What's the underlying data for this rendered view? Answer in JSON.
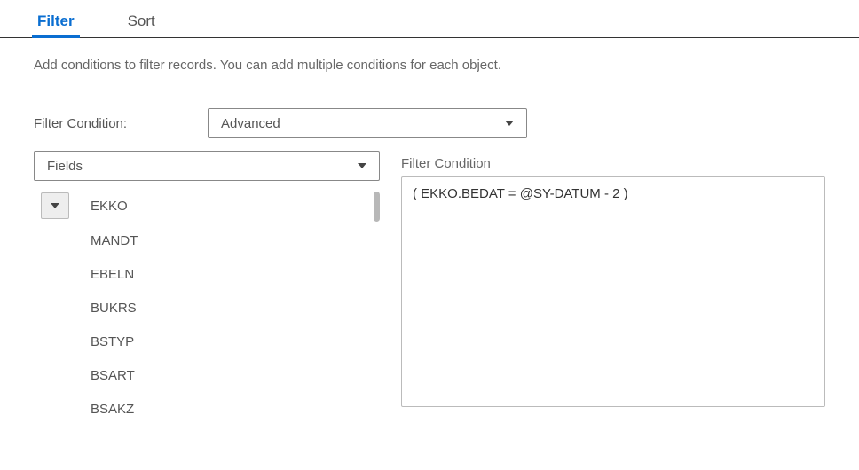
{
  "tabs": {
    "filter": "Filter",
    "sort": "Sort",
    "activeIndex": 0
  },
  "helptext": "Add conditions to filter records. You can add multiple conditions for each object.",
  "filterConditionLabel": "Filter Condition:",
  "filterConditionValue": "Advanced",
  "fieldsLabel": "Fields",
  "rightPanelLabel": "Filter Condition",
  "expression": "( EKKO.BEDAT = @SY-DATUM - 2 )",
  "tree": {
    "root": "EKKO",
    "children": [
      "MANDT",
      "EBELN",
      "BUKRS",
      "BSTYP",
      "BSART",
      "BSAKZ"
    ]
  }
}
